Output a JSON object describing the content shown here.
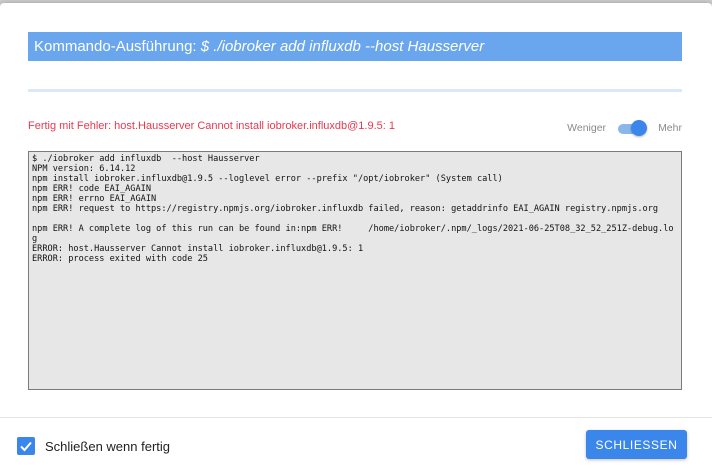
{
  "dialog": {
    "title_prefix": "Kommando-Ausführung: ",
    "title_command": "$ ./iobroker add influxdb --host Hausserver",
    "status_error": "Fertig mit Fehler: host.Hausserver Cannot install iobroker.influxdb@1.9.5: 1",
    "toggle": {
      "less_label": "Weniger",
      "more_label": "Mehr",
      "state": "Mehr"
    },
    "log_lines": [
      "$ ./iobroker add influxdb  --host Hausserver",
      "NPM version: 6.14.12",
      "npm install iobroker.influxdb@1.9.5 --loglevel error --prefix \"/opt/iobroker\" (System call)",
      "npm ERR! code EAI_AGAIN",
      "npm ERR! errno EAI_AGAIN",
      "npm ERR! request to https://registry.npmjs.org/iobroker.influxdb failed, reason: getaddrinfo EAI_AGAIN registry.npmjs.org",
      "",
      "npm ERR! A complete log of this run can be found in:npm ERR!     /home/iobroker/.npm/_logs/2021-06-25T08_32_52_251Z-debug.log",
      "ERROR: host.Hausserver Cannot install iobroker.influxdb@1.9.5: 1",
      "ERROR: process exited with code 25"
    ],
    "close_when_done_label": "Schließen wenn fertig",
    "close_when_done_checked": true,
    "close_button_label": "SCHLIESSEN"
  },
  "colors": {
    "accent": "#3a86ea",
    "title_bar": "#6aa6ee",
    "error": "#e8384f",
    "log_background": "#e7e7e7"
  }
}
